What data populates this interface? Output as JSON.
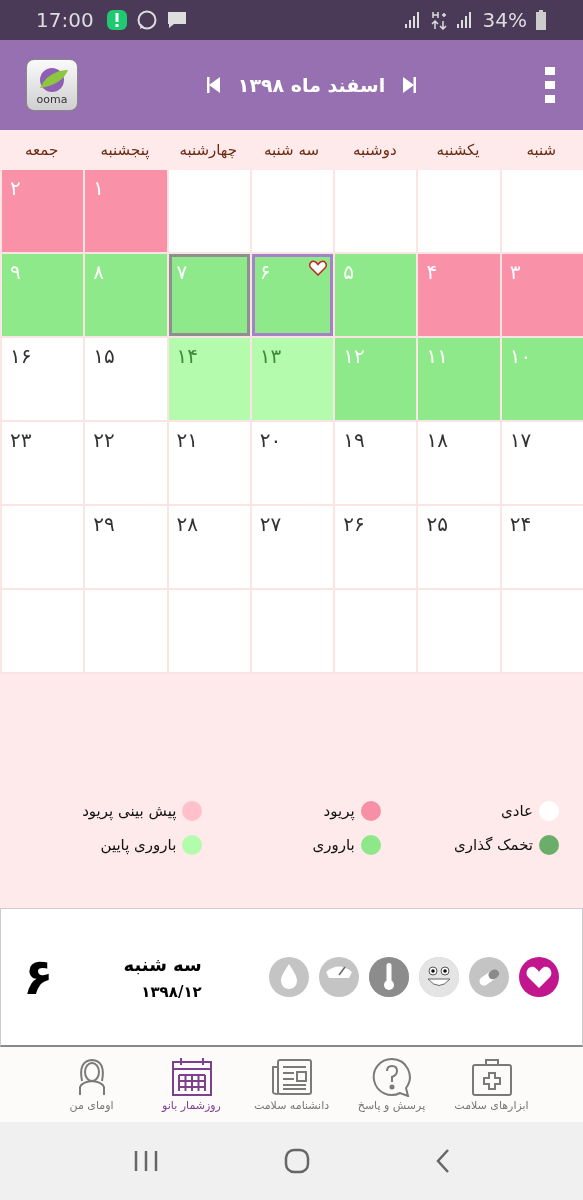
{
  "status_bar": {
    "time": "17:00",
    "battery": "34%"
  },
  "header": {
    "logo": "ooma",
    "title": "اسفند ماه ۱۳۹۸"
  },
  "weekdays": [
    "شنبه",
    "یکشنبه",
    "دوشنبه",
    "سه شنبه",
    "چهارشنبه",
    "پنجشنبه",
    "جمعه"
  ],
  "weeks": [
    [
      {
        "kind": "blank"
      },
      {
        "kind": "blank"
      },
      {
        "kind": "blank"
      },
      {
        "kind": "blank"
      },
      {
        "kind": "blank"
      },
      {
        "kind": "period",
        "day": "۱",
        "selected": false,
        "today": false,
        "note": false
      },
      {
        "kind": "period",
        "day": "۲",
        "selected": false,
        "today": false,
        "note": false
      }
    ],
    [
      {
        "kind": "period",
        "day": "۳",
        "selected": false,
        "today": false,
        "note": false
      },
      {
        "kind": "period",
        "day": "۴",
        "selected": false,
        "today": false,
        "note": false
      },
      {
        "kind": "fertile",
        "day": "۵",
        "selected": false,
        "today": false,
        "note": false
      },
      {
        "kind": "fertile",
        "day": "۶",
        "selected": true,
        "today": false,
        "note": true
      },
      {
        "kind": "fertile",
        "day": "۷",
        "selected": false,
        "today": true,
        "note": false
      },
      {
        "kind": "fertile",
        "day": "۸",
        "selected": false,
        "today": false,
        "note": false
      },
      {
        "kind": "fertile",
        "day": "۹",
        "selected": false,
        "today": false,
        "note": false
      }
    ],
    [
      {
        "kind": "fertile",
        "day": "۱۰",
        "selected": false,
        "today": false,
        "note": false
      },
      {
        "kind": "fertile",
        "day": "۱۱",
        "selected": false,
        "today": false,
        "note": false
      },
      {
        "kind": "fertile",
        "day": "۱۲",
        "selected": false,
        "today": false,
        "note": false
      },
      {
        "kind": "lowfertile",
        "day": "۱۳",
        "selected": false,
        "today": false,
        "note": false
      },
      {
        "kind": "lowfertile",
        "day": "۱۴",
        "selected": false,
        "today": false,
        "note": false
      },
      {
        "kind": "normal",
        "day": "۱۵",
        "selected": false,
        "today": false,
        "note": false
      },
      {
        "kind": "normal",
        "day": "۱۶",
        "selected": false,
        "today": false,
        "note": false
      }
    ],
    [
      {
        "kind": "normal",
        "day": "۱۷",
        "selected": false,
        "today": false,
        "note": false
      },
      {
        "kind": "normal",
        "day": "۱۸",
        "selected": false,
        "today": false,
        "note": false
      },
      {
        "kind": "normal",
        "day": "۱۹",
        "selected": false,
        "today": false,
        "note": false
      },
      {
        "kind": "normal",
        "day": "۲۰",
        "selected": false,
        "today": false,
        "note": false
      },
      {
        "kind": "normal",
        "day": "۲۱",
        "selected": false,
        "today": false,
        "note": false
      },
      {
        "kind": "normal",
        "day": "۲۲",
        "selected": false,
        "today": false,
        "note": false
      },
      {
        "kind": "normal",
        "day": "۲۳",
        "selected": false,
        "today": false,
        "note": false
      }
    ],
    [
      {
        "kind": "normal",
        "day": "۲۴",
        "selected": false,
        "today": false,
        "note": false
      },
      {
        "kind": "normal",
        "day": "۲۵",
        "selected": false,
        "today": false,
        "note": false
      },
      {
        "kind": "normal",
        "day": "۲۶",
        "selected": false,
        "today": false,
        "note": false
      },
      {
        "kind": "normal",
        "day": "۲۷",
        "selected": false,
        "today": false,
        "note": false
      },
      {
        "kind": "normal",
        "day": "۲۸",
        "selected": false,
        "today": false,
        "note": false
      },
      {
        "kind": "normal",
        "day": "۲۹",
        "selected": false,
        "today": false,
        "note": false
      },
      {
        "kind": "blank"
      }
    ],
    [
      {
        "kind": "blank"
      },
      {
        "kind": "blank"
      },
      {
        "kind": "blank"
      },
      {
        "kind": "blank"
      },
      {
        "kind": "blank"
      },
      {
        "kind": "blank"
      },
      {
        "kind": "blank"
      }
    ]
  ],
  "legend": [
    {
      "label": "عادی",
      "color": "#ffffff"
    },
    {
      "label": "پریود",
      "color": "#f78fa7"
    },
    {
      "label": "پیش بینی پریود",
      "color": "#ffc0cb"
    },
    {
      "label": "تخمک گذاری",
      "color": "#6aae6a"
    },
    {
      "label": "باروری",
      "color": "#8ee88a"
    },
    {
      "label": "باروری پایین",
      "color": "#b3fbad"
    }
  ],
  "detail": {
    "day": "۶",
    "weekday": "سه شنبه",
    "date": "۱۳۹۸/۱۲",
    "trackers": [
      {
        "kind": "heart",
        "active": true
      },
      {
        "kind": "pill",
        "active": false
      },
      {
        "kind": "mood",
        "active": false
      },
      {
        "kind": "temperature",
        "active": false
      },
      {
        "kind": "weight",
        "active": false
      },
      {
        "kind": "drop",
        "active": false
      }
    ]
  },
  "nav": [
    {
      "kind": "tools",
      "label": "ابزارهای سلامت",
      "selected": false
    },
    {
      "kind": "qa",
      "label": "پرسش و پاسخ",
      "selected": false
    },
    {
      "kind": "news",
      "label": "دانشنامه سلامت",
      "selected": false
    },
    {
      "kind": "calendar",
      "label": "روزشمار بانو",
      "selected": true
    },
    {
      "kind": "profile",
      "label": "اومای من",
      "selected": false
    }
  ]
}
